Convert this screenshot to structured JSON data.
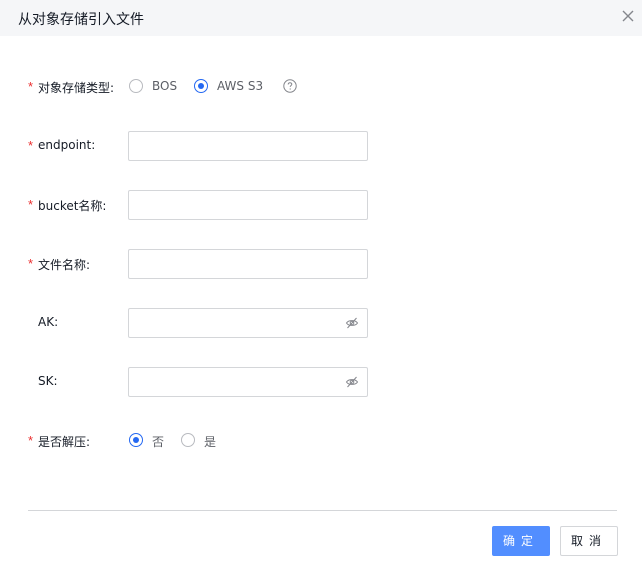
{
  "dialog": {
    "title": "从对象存储引入文件",
    "close_icon": "close-icon"
  },
  "form": {
    "storage_type": {
      "required_mark": "*",
      "label": "对象存储类型:",
      "options": [
        "BOS",
        "AWS S3"
      ],
      "selected": "AWS S3",
      "help_icon": "question-circle-icon"
    },
    "endpoint": {
      "required_mark": "*",
      "label": "endpoint:",
      "value": ""
    },
    "bucket": {
      "required_mark": "*",
      "label": "bucket名称:",
      "value": ""
    },
    "file_name": {
      "required_mark": "*",
      "label": "文件名称:",
      "value": ""
    },
    "ak": {
      "label": "AK:",
      "value": "",
      "icon": "eye-hidden-icon"
    },
    "sk": {
      "label": "SK:",
      "value": "",
      "icon": "eye-hidden-icon"
    },
    "decompress": {
      "required_mark": "*",
      "label": "是否解压:",
      "options": [
        "否",
        "是"
      ],
      "selected": "否"
    }
  },
  "footer": {
    "confirm_label": "确定",
    "cancel_label": "取消"
  },
  "colors": {
    "primary": "#528eff",
    "radio_checked": "#2468f2",
    "required": "#ea2e2e",
    "border": "#d4d6d9",
    "header_bg": "#f5f6f8"
  }
}
